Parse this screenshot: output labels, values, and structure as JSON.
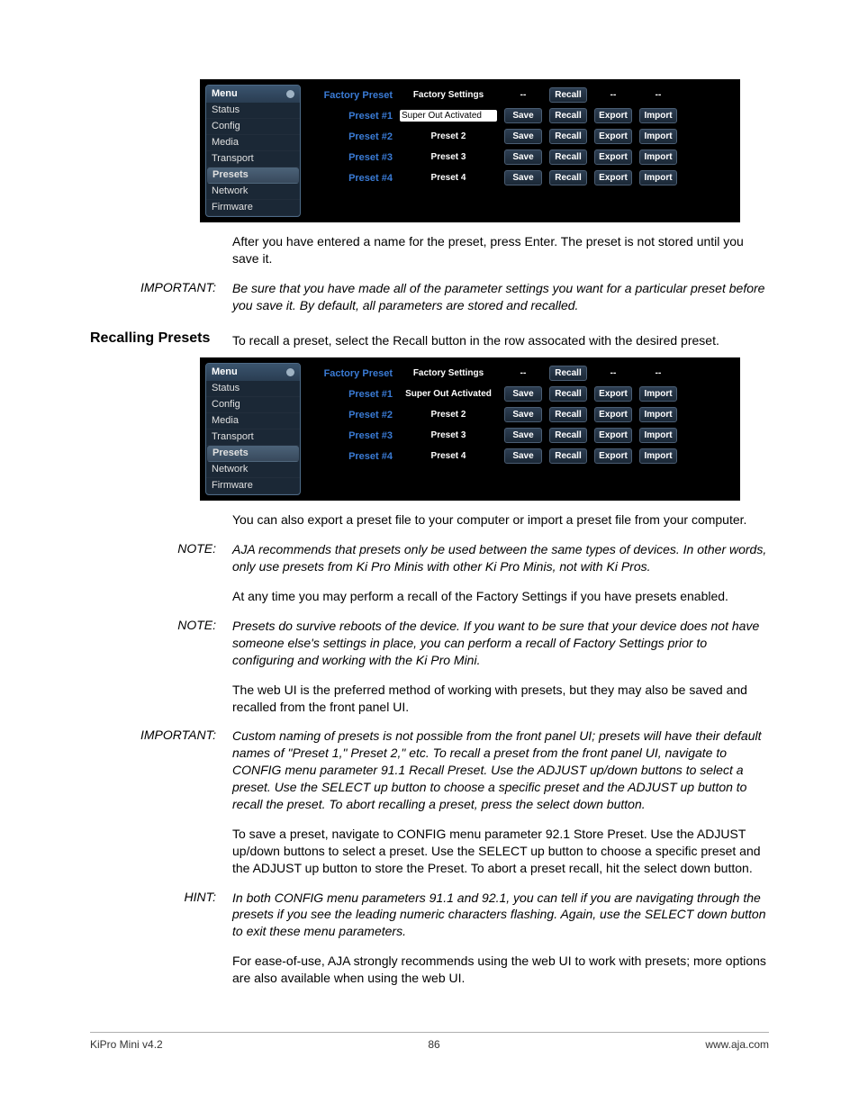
{
  "ui1": {
    "menu_label": "Menu",
    "sidebar": [
      "Status",
      "Config",
      "Media",
      "Transport",
      "Presets",
      "Network",
      "Firmware"
    ],
    "selected": "Presets",
    "header": {
      "label": "Factory Preset",
      "name": "Factory Settings",
      "recall": "Recall"
    },
    "rows": [
      {
        "label": "Preset #1",
        "name": "Super Out Activated",
        "editable": true,
        "save": "Save",
        "recall": "Recall",
        "export": "Export",
        "import": "Import"
      },
      {
        "label": "Preset #2",
        "name": "Preset 2",
        "save": "Save",
        "recall": "Recall",
        "export": "Export",
        "import": "Import"
      },
      {
        "label": "Preset #3",
        "name": "Preset 3",
        "save": "Save",
        "recall": "Recall",
        "export": "Export",
        "import": "Import"
      },
      {
        "label": "Preset #4",
        "name": "Preset 4",
        "save": "Save",
        "recall": "Recall",
        "export": "Export",
        "import": "Import"
      }
    ]
  },
  "ui2": {
    "menu_label": "Menu",
    "sidebar": [
      "Status",
      "Config",
      "Media",
      "Transport",
      "Presets",
      "Network",
      "Firmware"
    ],
    "selected": "Presets",
    "header": {
      "label": "Factory Preset",
      "name": "Factory Settings",
      "recall": "Recall"
    },
    "rows": [
      {
        "label": "Preset #1",
        "name": "Super Out Activated",
        "save": "Save",
        "recall": "Recall",
        "export": "Export",
        "import": "Import"
      },
      {
        "label": "Preset #2",
        "name": "Preset 2",
        "save": "Save",
        "recall": "Recall",
        "export": "Export",
        "import": "Import"
      },
      {
        "label": "Preset #3",
        "name": "Preset 3",
        "save": "Save",
        "recall": "Recall",
        "export": "Export",
        "import": "Import"
      },
      {
        "label": "Preset #4",
        "name": "Preset 4",
        "save": "Save",
        "recall": "Recall",
        "export": "Export",
        "import": "Import"
      }
    ]
  },
  "para_after_ui1": "After you have entered a name for the preset, press Enter. The preset is not stored until you save it.",
  "important1_label": "IMPORTANT:",
  "important1": "Be sure that you have made all of the parameter settings you want for a particular preset before you save it.  By default, all parameters are stored and recalled.",
  "section_heading": "Recalling Presets",
  "section_lead": "To recall a preset, select the Recall button in the row assocated with the desired preset.",
  "para_after_ui2": "You can also export a preset file to your computer or import a preset file from your computer.",
  "note1_label": "NOTE:",
  "note1": "AJA recommends that presets only be used between the same types of devices.  In other words, only use presets from Ki Pro Minis with other Ki Pro Minis, not with Ki Pros.",
  "para_anytime": "At any time you may perform a recall of the Factory Settings if you have presets enabled.",
  "note2_label": "NOTE:",
  "note2": "Presets do survive reboots of the device. If you want to be sure that your device does not have someone else's settings in place, you can perform a recall of Factory Settings prior to configuring and working with the Ki Pro Mini.",
  "para_webui": "The web UI is the preferred method of working with presets, but they may also be saved and recalled from the front panel UI.",
  "important2_label": "IMPORTANT:",
  "important2": "Custom naming of presets is not possible from the front panel UI; presets will have their default names of \"Preset 1,\" Preset 2,\" etc. To recall a preset from the front panel UI, navigate to CONFIG menu parameter 91.1 Recall Preset. Use the ADJUST up/down buttons to select a preset.  Use the SELECT up button to choose a specific preset and the ADJUST up button to recall the preset.  To abort recalling a preset, press the select down button.",
  "para_save": "To save a preset, navigate to CONFIG menu parameter 92.1 Store Preset. Use the ADJUST up/down buttons to select a preset. Use the SELECT up button to choose a specific preset and the ADJUST up button to store the Preset. To abort a preset recall, hit the select down button.",
  "hint_label": "HINT:",
  "hint": "In both CONFIG menu parameters 91.1 and 92.1, you can tell if you are navigating through the presets if you see the leading numeric characters flashing. Again, use the SELECT down button to exit these menu parameters.",
  "para_ease": "For ease-of-use, AJA strongly recommends using the web UI to work with presets; more options are also available when using the web UI.",
  "footer_left": "KiPro Mini v4.2",
  "footer_page": "86",
  "footer_right": "www.aja.com"
}
